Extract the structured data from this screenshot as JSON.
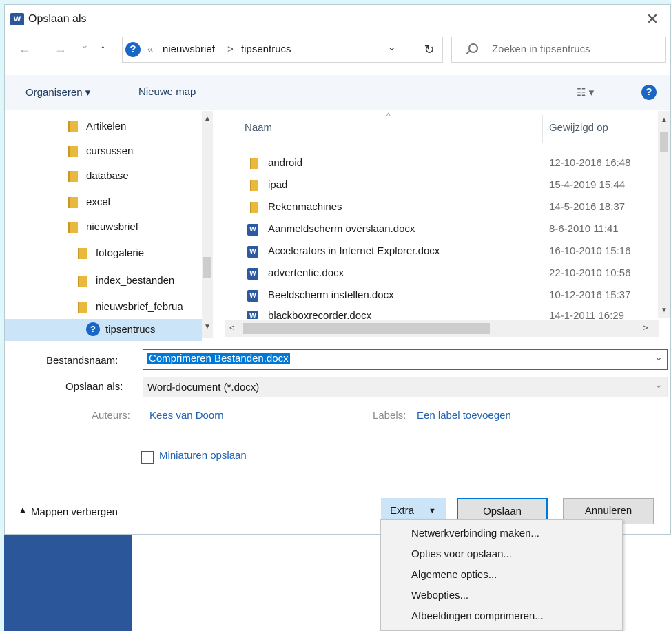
{
  "dialog": {
    "title": "Opslaan als",
    "close_glyph": "✕"
  },
  "nav": {
    "back_glyph": "←",
    "forward_glyph": "→",
    "recent_glyph": "⌄",
    "up_glyph": "↑",
    "overflow": "«",
    "breadcrumb": [
      "nieuwsbrief",
      "tipsentrucs"
    ],
    "separator": ">",
    "refresh_glyph": "↻",
    "dropdown_glyph": "⌄",
    "search_placeholder": "Zoeken in tipsentrucs"
  },
  "toolbar": {
    "organize": "Organiseren ▾",
    "new_folder": "Nieuwe map",
    "view_glyph": "☷ ▾",
    "help_glyph": "?"
  },
  "tree": {
    "items": [
      {
        "label": "Artikelen",
        "level": 1
      },
      {
        "label": "cursussen",
        "level": 1
      },
      {
        "label": "database",
        "level": 1
      },
      {
        "label": "excel",
        "level": 1
      },
      {
        "label": "nieuwsbrief",
        "level": 1
      },
      {
        "label": "fotogalerie",
        "level": 2
      },
      {
        "label": "index_bestanden",
        "level": 2
      },
      {
        "label": "nieuwsbrief_februa",
        "level": 2
      }
    ],
    "selected": "tipsentrucs"
  },
  "files": {
    "col_name": "Naam",
    "col_date": "Gewijzigd op",
    "rows": [
      {
        "name": "android",
        "date": "12-10-2016 16:48",
        "type": "folder"
      },
      {
        "name": "ipad",
        "date": "15-4-2019 15:44",
        "type": "folder"
      },
      {
        "name": "Rekenmachines",
        "date": "14-5-2016 18:37",
        "type": "folder"
      },
      {
        "name": "Aanmeldscherm overslaan.docx",
        "date": "8-6-2010 11:41",
        "type": "doc"
      },
      {
        "name": "Accelerators in Internet Explorer.docx",
        "date": "16-10-2010 15:16",
        "type": "doc"
      },
      {
        "name": "advertentie.docx",
        "date": "22-10-2010 10:56",
        "type": "doc"
      },
      {
        "name": "Beeldscherm instellen.docx",
        "date": "10-12-2016 15:37",
        "type": "doc"
      },
      {
        "name": "blackboxrecorder.docx",
        "date": "14-1-2011 16:29",
        "type": "doc"
      }
    ]
  },
  "form": {
    "filename_label": "Bestandsnaam:",
    "filename_value": "Comprimeren Bestanden.docx",
    "savetype_label": "Opslaan als:",
    "savetype_value": "Word-document (*.docx)",
    "authors_label": "Auteurs:",
    "authors_value": "Kees van Doorn",
    "tags_label": "Labels:",
    "tags_value": "Een label toevoegen",
    "thumbnails_label": "Miniaturen opslaan"
  },
  "footer": {
    "hide_folders": "Mappen verbergen",
    "tools": "Extra",
    "save": "Opslaan",
    "cancel": "Annuleren"
  },
  "tools_menu": {
    "items": [
      "Netwerkverbinding maken...",
      "Opties voor opslaan...",
      "Algemene opties...",
      "Webopties...",
      "Afbeeldingen comprimeren..."
    ]
  },
  "colors": {
    "accent": "#1a66c7",
    "selection": "#0078d7",
    "word_blue": "#2b579a"
  }
}
